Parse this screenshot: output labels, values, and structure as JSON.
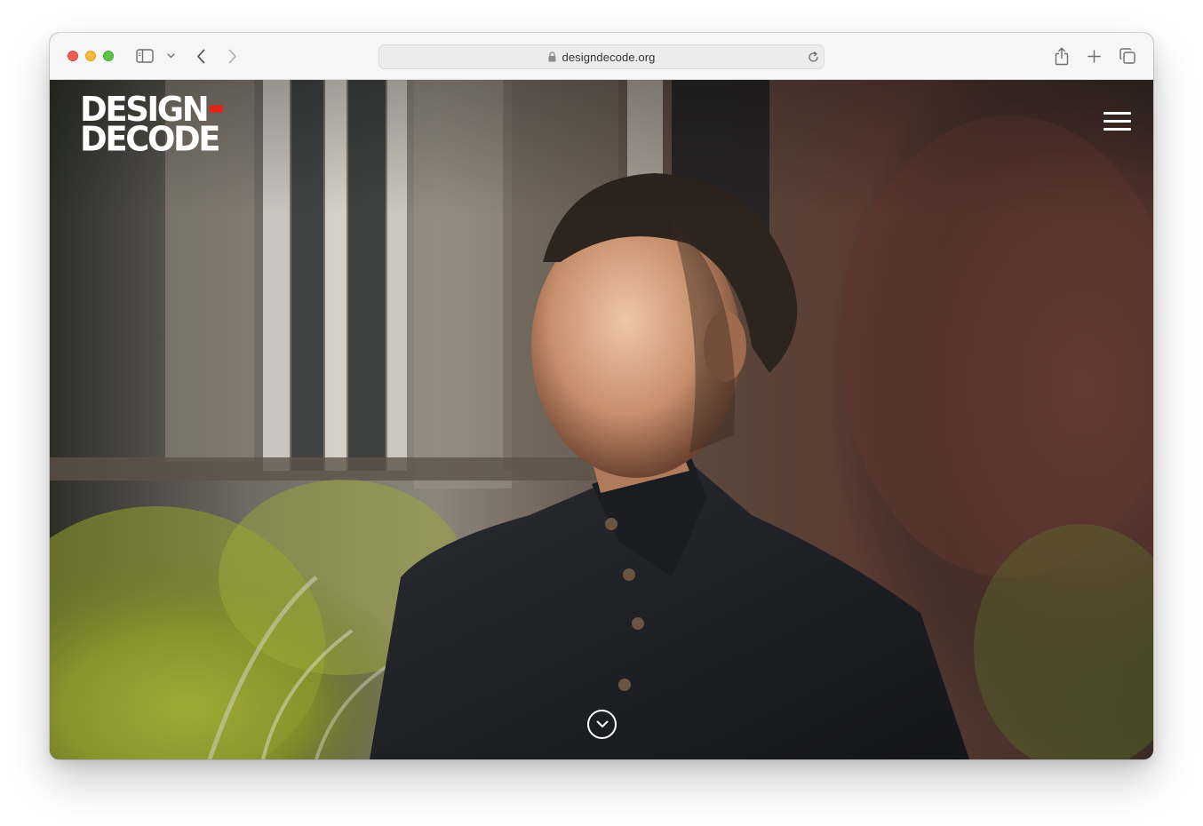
{
  "browser": {
    "url": "designdecode.org",
    "icons": {
      "sidebar": "sidebar-icon",
      "chevron": "chevron-down-icon",
      "back": "back-arrow-icon",
      "forward": "forward-arrow-icon",
      "lock": "lock-icon",
      "reload": "reload-icon",
      "share": "share-icon",
      "new_tab": "plus-icon",
      "tabs": "tab-overview-icon"
    }
  },
  "site": {
    "logo_line1": "DESIGN",
    "logo_line2": "DECODE",
    "logo_accent_color": "#e2231a",
    "menu_icon": "hamburger-menu-icon",
    "scroll_icon": "chevron-down-circle-icon"
  },
  "hero": {
    "image_subject": "portrait-photo"
  }
}
